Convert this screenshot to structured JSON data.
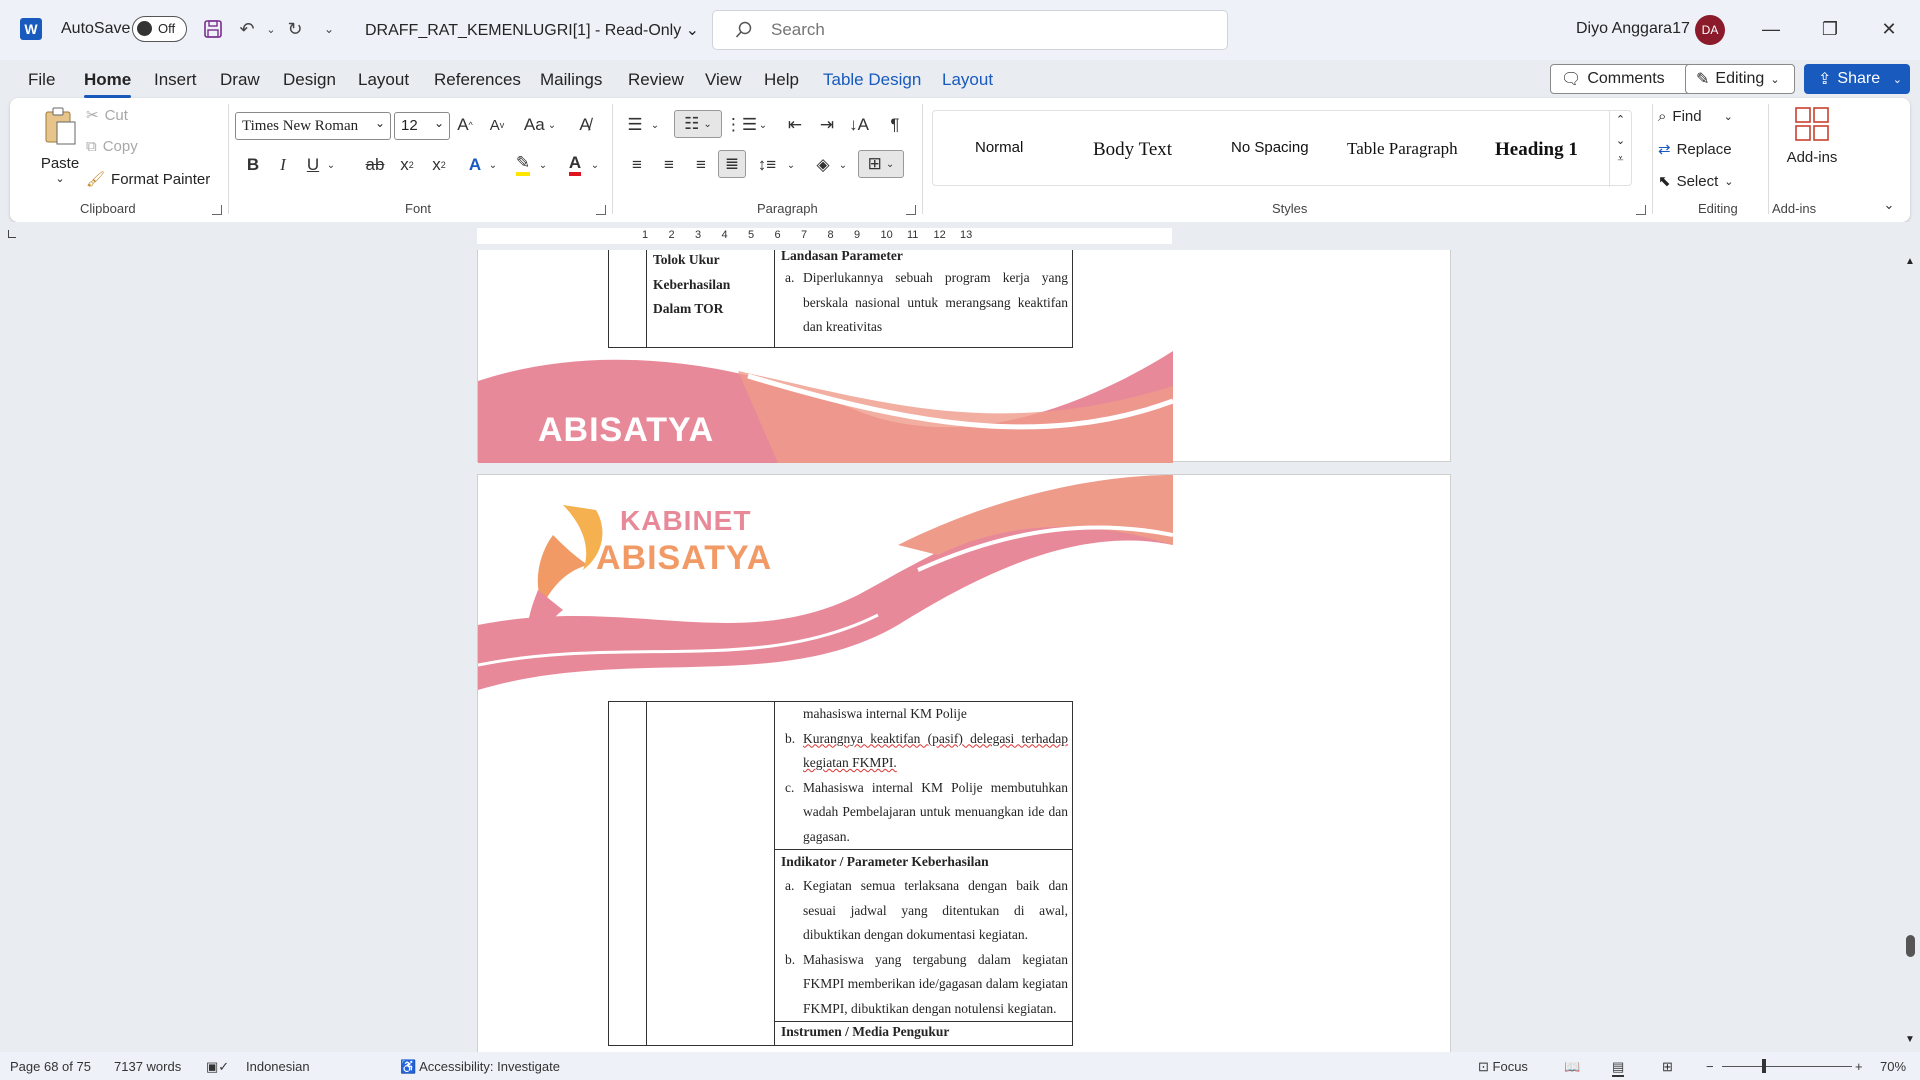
{
  "titlebar": {
    "app_logo": "W",
    "autosave_label": "AutoSave",
    "autosave_state": "Off",
    "doc_title": "DRAFF_RAT_KEMENLUGRI[1]  -  Read-Only",
    "search_placeholder": "Search",
    "user_name": "Diyo Anggara17",
    "user_initials": "DA"
  },
  "tabs": [
    "File",
    "Home",
    "Insert",
    "Draw",
    "Design",
    "Layout",
    "References",
    "Mailings",
    "Review",
    "View",
    "Help",
    "Table Design",
    "Layout"
  ],
  "actions": {
    "comments": "Comments",
    "editing": "Editing",
    "share": "Share"
  },
  "ribbon": {
    "clipboard": {
      "paste": "Paste",
      "cut": "Cut",
      "copy": "Copy",
      "format_painter": "Format Painter",
      "label": "Clipboard"
    },
    "font": {
      "family": "Times New Roman",
      "size": "12",
      "label": "Font",
      "case": "Aa"
    },
    "paragraph": {
      "label": "Paragraph"
    },
    "styles": {
      "items": [
        "Normal",
        "Body Text",
        "No Spacing",
        "Table Paragraph",
        "Heading 1"
      ],
      "label": "Styles"
    },
    "editing": {
      "find": "Find",
      "replace": "Replace",
      "select": "Select",
      "label": "Editing"
    },
    "addins": {
      "button": "Add-ins",
      "label": "Add-ins"
    }
  },
  "ruler": {
    "marks": [
      "1",
      "2",
      "3",
      "4",
      "5",
      "6",
      "7",
      "8",
      "9",
      "10",
      "11",
      "12",
      "13"
    ]
  },
  "document": {
    "page1": {
      "col2_heading": "Tolok Ukur Keberhasilan Dalam TOR",
      "col3_heading": "Landasan Parameter",
      "item_a_marker": "a.",
      "item_a": "Diperlukannya sebuah program kerja yang berskala nasional untuk merangsang keaktifan dan kreativitas",
      "footer_brand": "ABISATYA"
    },
    "page2": {
      "header_brand_line1": "KABINET",
      "header_brand_line2": "ABISATYA",
      "cont_text": "mahasiswa internal KM Polije",
      "item_b_marker": "b.",
      "item_b": "Kurangnya keaktifan  (pasif) delegasi terhadap kegiatan FKMPI.",
      "item_c_marker": "c.",
      "item_c": "Mahasiswa internal KM Polije membutuhkan wadah Pembelajaran untuk menuangkan ide dan gagasan.",
      "indikator_heading": "Indikator / Parameter Keberhasilan",
      "ind_a_marker": "a.",
      "ind_a": "Kegiatan semua terlaksana dengan baik dan sesuai jadwal yang ditentukan di awal, dibuktikan dengan dokumentasi kegiatan.",
      "ind_b_marker": "b.",
      "ind_b": "Mahasiswa yang tergabung dalam kegiatan FKMPI memberikan ide/gagasan dalam kegiatan FKMPI, dibuktikan dengan notulensi kegiatan.",
      "instrumen_heading": "Instrumen / Media Pengukur"
    }
  },
  "statusbar": {
    "page": "Page 68 of 75",
    "words": "7137 words",
    "language": "Indonesian",
    "accessibility": "Accessibility: Investigate",
    "focus": "Focus",
    "zoom": "70%"
  },
  "colors": {
    "accent": "#185abd",
    "brand_pink": "#e8899a",
    "brand_salmon": "#ef9b8a",
    "avatar": "#8b1a2a"
  }
}
